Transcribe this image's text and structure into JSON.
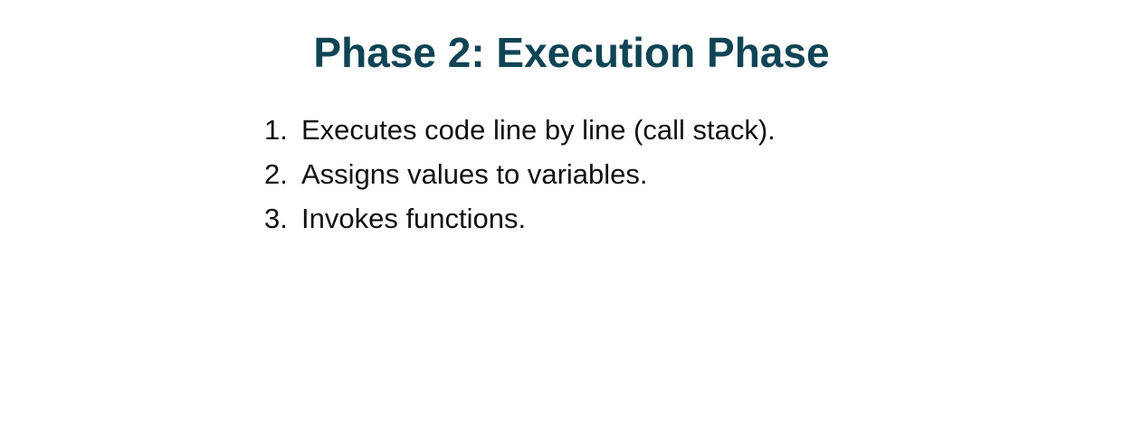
{
  "slide": {
    "title": "Phase 2: Execution Phase",
    "items": [
      {
        "number": "1.",
        "text": "Executes code line by line (call stack)."
      },
      {
        "number": "2.",
        "text": "Assigns values to variables."
      },
      {
        "number": "3.",
        "text": "Invokes functions."
      }
    ]
  },
  "colors": {
    "title": "#0f4455",
    "body_text": "#111111",
    "background": "#ffffff"
  }
}
